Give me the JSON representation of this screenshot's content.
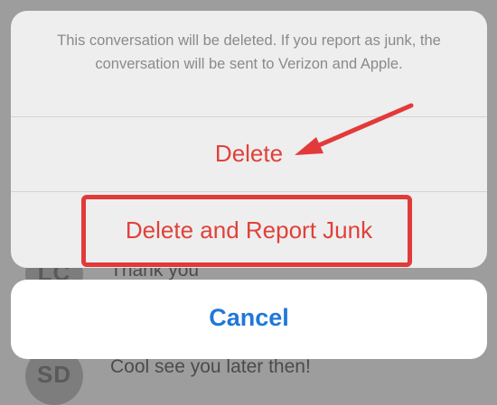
{
  "background": {
    "rows": [
      {
        "avatar": "LC",
        "text": "Thank you"
      },
      {
        "avatar": "SD",
        "text": "Cool see you later then!"
      }
    ]
  },
  "sheet": {
    "message": "This conversation will be deleted. If you report as junk, the conversation will be sent to Verizon and Apple.",
    "actions": {
      "delete_label": "Delete",
      "delete_and_report_label": "Delete and Report Junk"
    },
    "cancel_label": "Cancel"
  },
  "colors": {
    "destructive": "#e0413b",
    "cancel": "#1f78d8",
    "annotation": "#e23a3a"
  }
}
